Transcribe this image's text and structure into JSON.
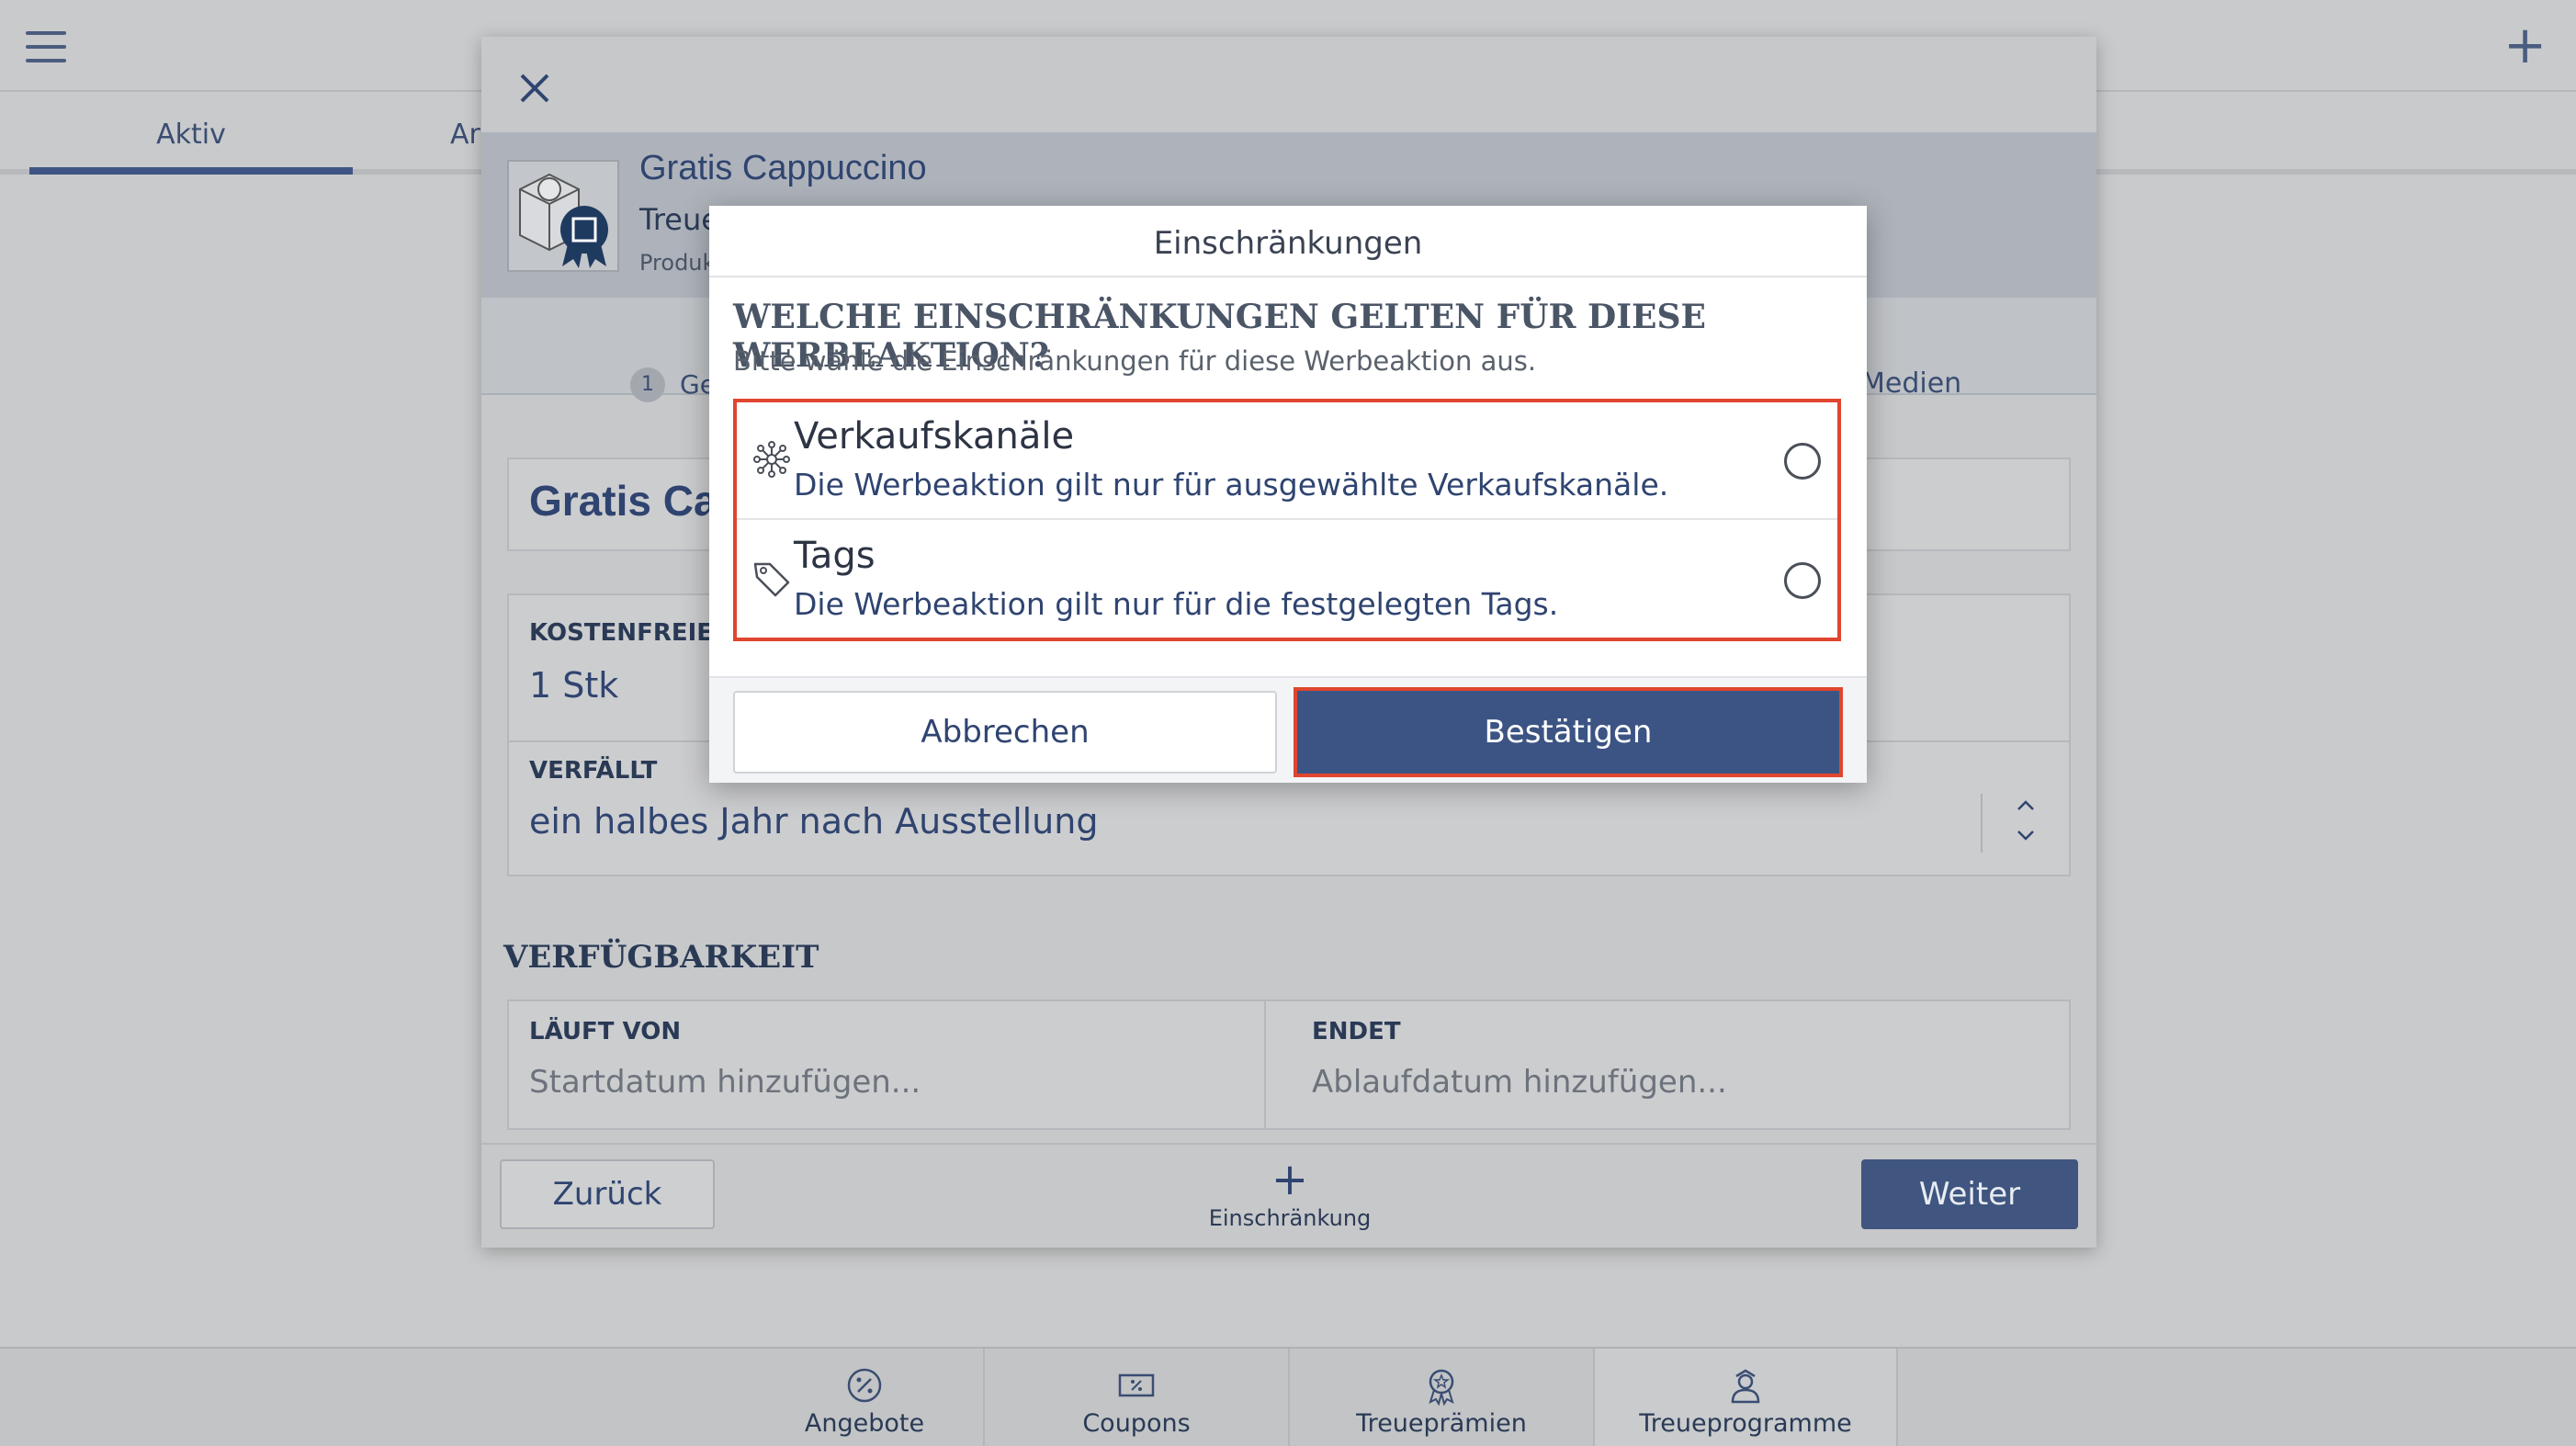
{
  "app": {
    "top_plus": "+",
    "tabs": [
      {
        "label": "Aktiv"
      },
      {
        "label": "Ar"
      }
    ]
  },
  "bottom_nav": [
    {
      "label": "Angebote",
      "icon": "percent-badge-icon"
    },
    {
      "label": "Coupons",
      "icon": "coupon-icon"
    },
    {
      "label": "Treueprämien",
      "icon": "award-icon"
    },
    {
      "label": "Treueprogramme",
      "icon": "loyalty-person-icon"
    }
  ],
  "panel": {
    "product_title": "Gratis Cappuccino",
    "product_subtitle": "Treue",
    "product_subtitle2": "Produk",
    "step_number": "1",
    "step_label": "Ge",
    "step_media": "Medien",
    "name_value": "Gratis Cap",
    "free_units_label": "KOSTENFREIE EI",
    "free_units_value": "1 Stk",
    "expires_label": "VERFÄLLT",
    "expires_value": "ein halbes Jahr nach Ausstellung",
    "availability_title": "VERFÜGBARKEIT",
    "runs_from_label": "LÄUFT VON",
    "runs_from_placeholder": "Startdatum hinzufügen...",
    "ends_label": "ENDET",
    "ends_placeholder": "Ablaufdatum hinzufügen...",
    "back_button": "Zurück",
    "add_restriction_plus": "+",
    "add_restriction_label": "Einschränkung",
    "next_button": "Weiter"
  },
  "modal": {
    "title": "Einschränkungen",
    "question": "WELCHE EINSCHRÄNKUNGEN GELTEN FÜR DIESE WERBEAKTION?",
    "hint": "Bitte wähle die Einschränkungen für diese Werbeaktion aus.",
    "options": [
      {
        "title": "Verkaufskanäle",
        "description": "Die Werbeaktion gilt nur für ausgewählte Verkaufskanäle.",
        "icon": "channels-icon",
        "selected": false
      },
      {
        "title": "Tags",
        "description": "Die Werbeaktion gilt nur für die festgelegten Tags.",
        "icon": "tag-icon",
        "selected": false
      }
    ],
    "cancel_button": "Abbrechen",
    "confirm_button": "Bestätigen"
  },
  "colors": {
    "primary": "#3c5484",
    "highlight": "#e0452f",
    "overlay": "#c9cacb"
  }
}
